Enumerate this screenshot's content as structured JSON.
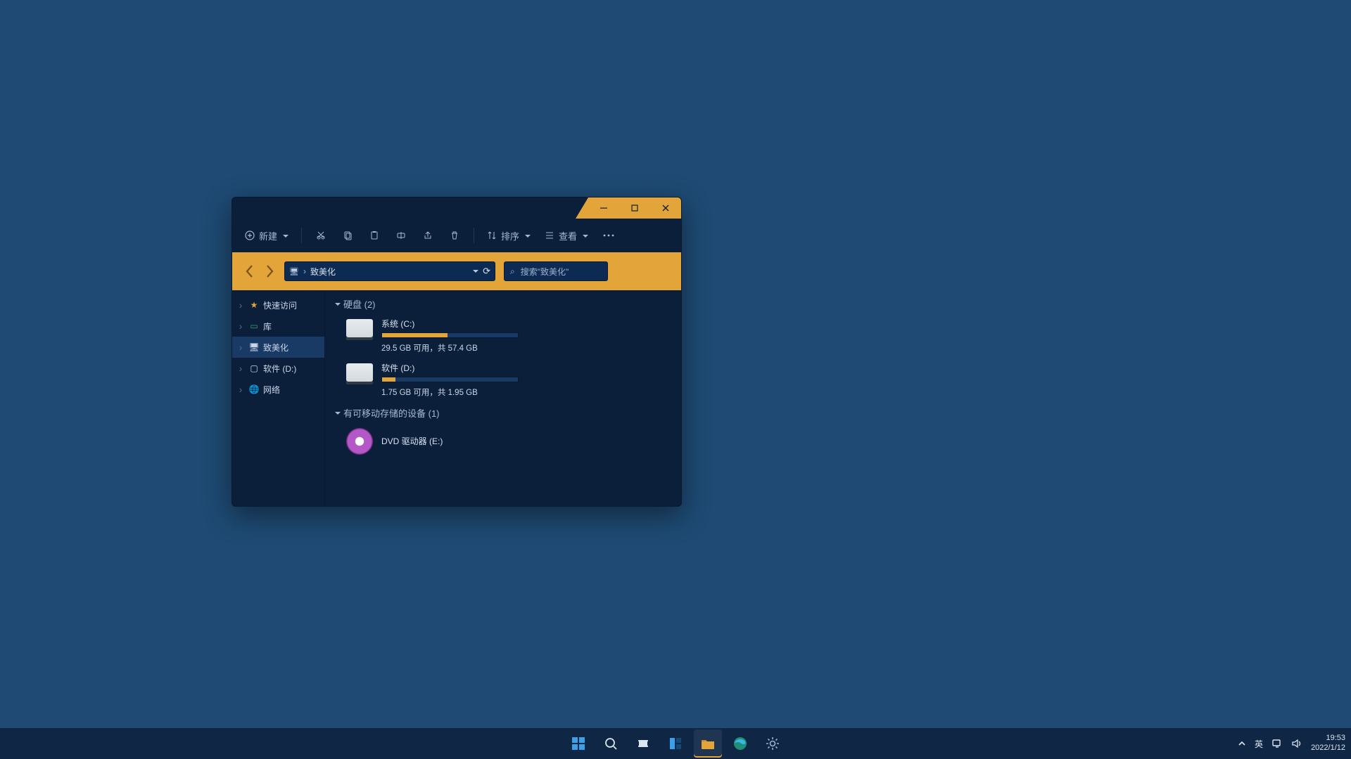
{
  "colors": {
    "accent": "#e3a53a",
    "window_bg": "#0c1f3a",
    "desktop": "#1e4a73",
    "address_field": "#0c2a52"
  },
  "toolbar": {
    "new": "新建",
    "sort": "排序",
    "view": "查看"
  },
  "address": {
    "path_segments": [
      "致美化"
    ],
    "search_placeholder": "搜索\"致美化\""
  },
  "sidebar": {
    "items": [
      {
        "label": "快速访问",
        "icon": "star",
        "active": false
      },
      {
        "label": "库",
        "icon": "library",
        "active": false
      },
      {
        "label": "致美化",
        "icon": "monitor",
        "active": true
      },
      {
        "label": "软件 (D:)",
        "icon": "disk",
        "active": false
      },
      {
        "label": "网络",
        "icon": "globe",
        "active": false
      }
    ]
  },
  "content": {
    "groups": [
      {
        "title": "硬盘 (2)",
        "drives": [
          {
            "name": "系统 (C:)",
            "free": "29.5 GB",
            "total": "57.4 GB",
            "fill_pct": 48,
            "sub": "29.5 GB 可用，共 57.4 GB"
          },
          {
            "name": "软件 (D:)",
            "free": "1.75 GB",
            "total": "1.95 GB",
            "fill_pct": 10,
            "sub": "1.75 GB 可用，共 1.95 GB"
          }
        ]
      },
      {
        "title": "有可移动存储的设备 (1)",
        "removable": [
          {
            "name": "DVD 驱动器 (E:)"
          }
        ]
      }
    ]
  },
  "tray": {
    "ime": "英",
    "time": "19:53",
    "date": "2022/1/12"
  }
}
